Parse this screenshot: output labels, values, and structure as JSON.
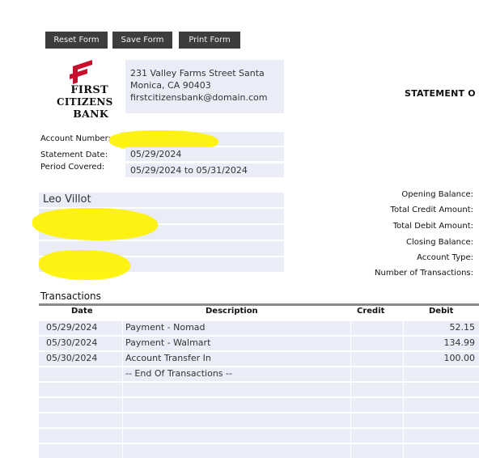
{
  "toolbar": {
    "reset_label": "Reset Form",
    "save_label": "Save Form",
    "print_label": "Print Form"
  },
  "bank": {
    "logo_line1": "FIRST",
    "logo_line2": "CITIZENS",
    "logo_line3": "BANK",
    "address_line1": "231 Valley Farms Street Santa",
    "address_line2": "Monica, CA 90403",
    "email": "firstcitizensbank@domain.com",
    "logo_color": "#c8102e"
  },
  "statement_title": "STATEMENT O",
  "account": {
    "account_number_label": "Account Number:",
    "account_number_value": "",
    "statement_date_label": "Statement Date:",
    "statement_date_value": "05/29/2024",
    "period_label": "Period Covered:",
    "period_value": "05/29/2024 to 05/31/2024"
  },
  "customer": {
    "name": "Leo Villot"
  },
  "summary_labels": {
    "opening": "Opening Balance:",
    "credit": "Total Credit Amount:",
    "debit": "Total Debit Amount:",
    "closing": "Closing Balance:",
    "type": "Account Type:",
    "count": "Number of Transactions:"
  },
  "transactions": {
    "title": "Transactions",
    "headers": {
      "date": "Date",
      "description": "Description",
      "credit": "Credit",
      "debit": "Debit"
    },
    "rows": [
      {
        "date": "05/29/2024",
        "description": "Payment - Nomad",
        "credit": "",
        "debit": "52.15"
      },
      {
        "date": "05/30/2024",
        "description": "Payment - Walmart",
        "credit": "",
        "debit": "134.99"
      },
      {
        "date": "05/30/2024",
        "description": "Account Transfer In",
        "credit": "",
        "debit": "100.00"
      },
      {
        "date": "",
        "description": "-- End Of Transactions --",
        "credit": "",
        "debit": ""
      },
      {
        "date": "",
        "description": "",
        "credit": "",
        "debit": ""
      },
      {
        "date": "",
        "description": "",
        "credit": "",
        "debit": ""
      },
      {
        "date": "",
        "description": "",
        "credit": "",
        "debit": ""
      },
      {
        "date": "",
        "description": "",
        "credit": "",
        "debit": ""
      },
      {
        "date": "",
        "description": "",
        "credit": "",
        "debit": ""
      }
    ]
  },
  "colors": {
    "button_bg": "#3d3d3d",
    "field_bg": "#eaedf7",
    "redaction": "#fff200"
  }
}
